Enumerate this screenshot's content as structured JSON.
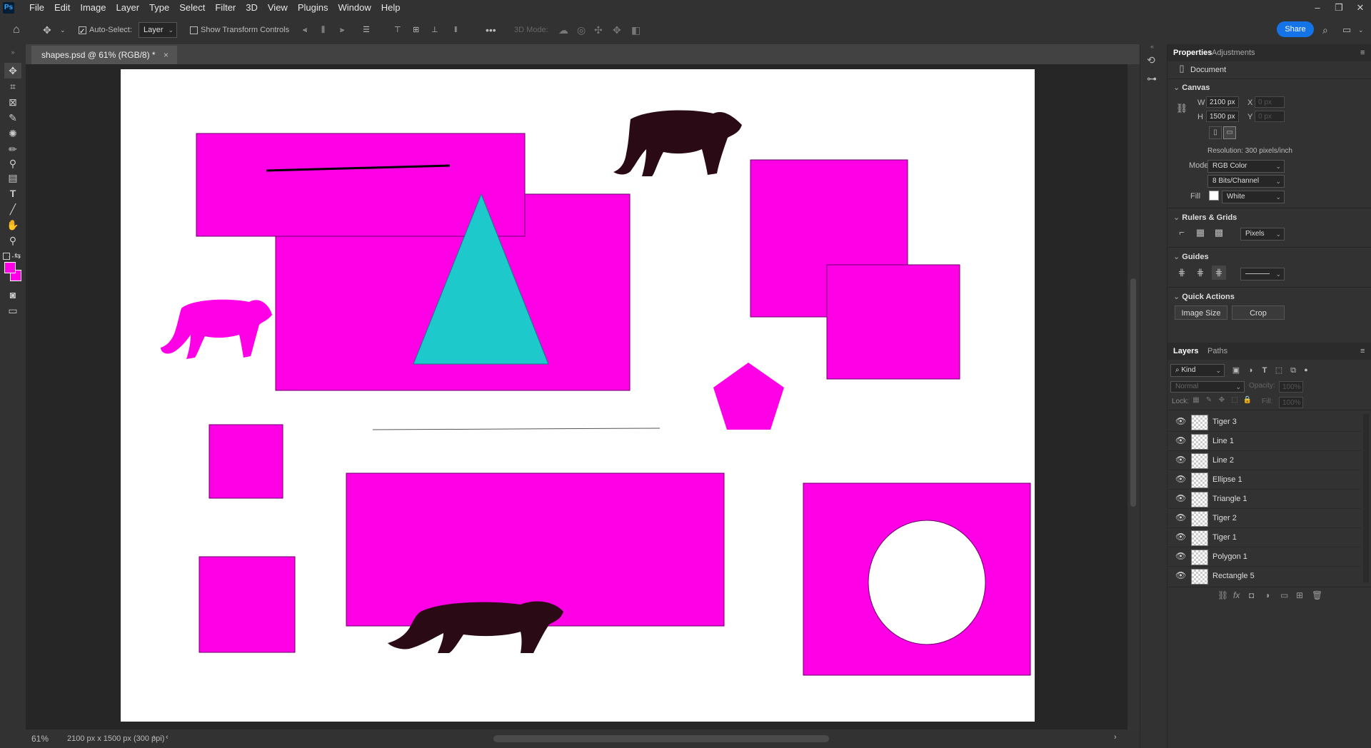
{
  "app": {
    "logo": "Ps"
  },
  "menu": [
    "File",
    "Edit",
    "Image",
    "Layer",
    "Type",
    "Select",
    "Filter",
    "3D",
    "View",
    "Plugins",
    "Window",
    "Help"
  ],
  "options": {
    "auto_select_label": "Auto-Select:",
    "auto_select_checked": true,
    "auto_select_value": "Layer",
    "transform_label": "Show Transform Controls",
    "mode_3d_label": "3D Mode:",
    "share_label": "Share"
  },
  "document": {
    "tab_title": "shapes.psd @ 61% (RGB/8) *",
    "close": "×"
  },
  "status": {
    "zoom": "61%",
    "info": "2100 px x 1500 px (300 ppi)"
  },
  "colors": {
    "foreground": "#ff00e6",
    "background": "#ff00e6",
    "shape_fill": "#ff00e6",
    "triangle": "#1ec9cc",
    "tiger": "#2a0a14"
  },
  "properties": {
    "tabs": [
      "Properties",
      "Adjustments"
    ],
    "kind": "Document",
    "canvas": {
      "title": "Canvas",
      "w_label": "W",
      "w_value": "2100 px",
      "h_label": "H",
      "h_value": "1500 px",
      "x_label": "X",
      "x_value": "0 px",
      "y_label": "Y",
      "y_value": "0 px",
      "resolution": "Resolution: 300 pixels/inch",
      "mode_label": "Mode",
      "mode_value": "RGB Color",
      "bits_value": "8 Bits/Channel",
      "fill_label": "Fill",
      "fill_value": "White"
    },
    "rulers": {
      "title": "Rulers & Grids",
      "units": "Pixels"
    },
    "guides": {
      "title": "Guides"
    },
    "quick": {
      "title": "Quick Actions",
      "image_size": "Image Size",
      "crop": "Crop"
    }
  },
  "layers_panel": {
    "tabs": [
      "Layers",
      "Paths"
    ],
    "filter_kind": "Kind",
    "blend_mode": "Normal",
    "opacity_label": "Opacity:",
    "opacity_value": "100%",
    "lock_label": "Lock:",
    "fill_label": "Fill:",
    "fill_value": "100%",
    "layers": [
      "Tiger 3",
      "Line 1",
      "Line 2",
      "Ellipse 1",
      "Triangle 1",
      "Tiger 2",
      "Tiger 1",
      "Polygon 1",
      "Rectangle 5"
    ]
  }
}
